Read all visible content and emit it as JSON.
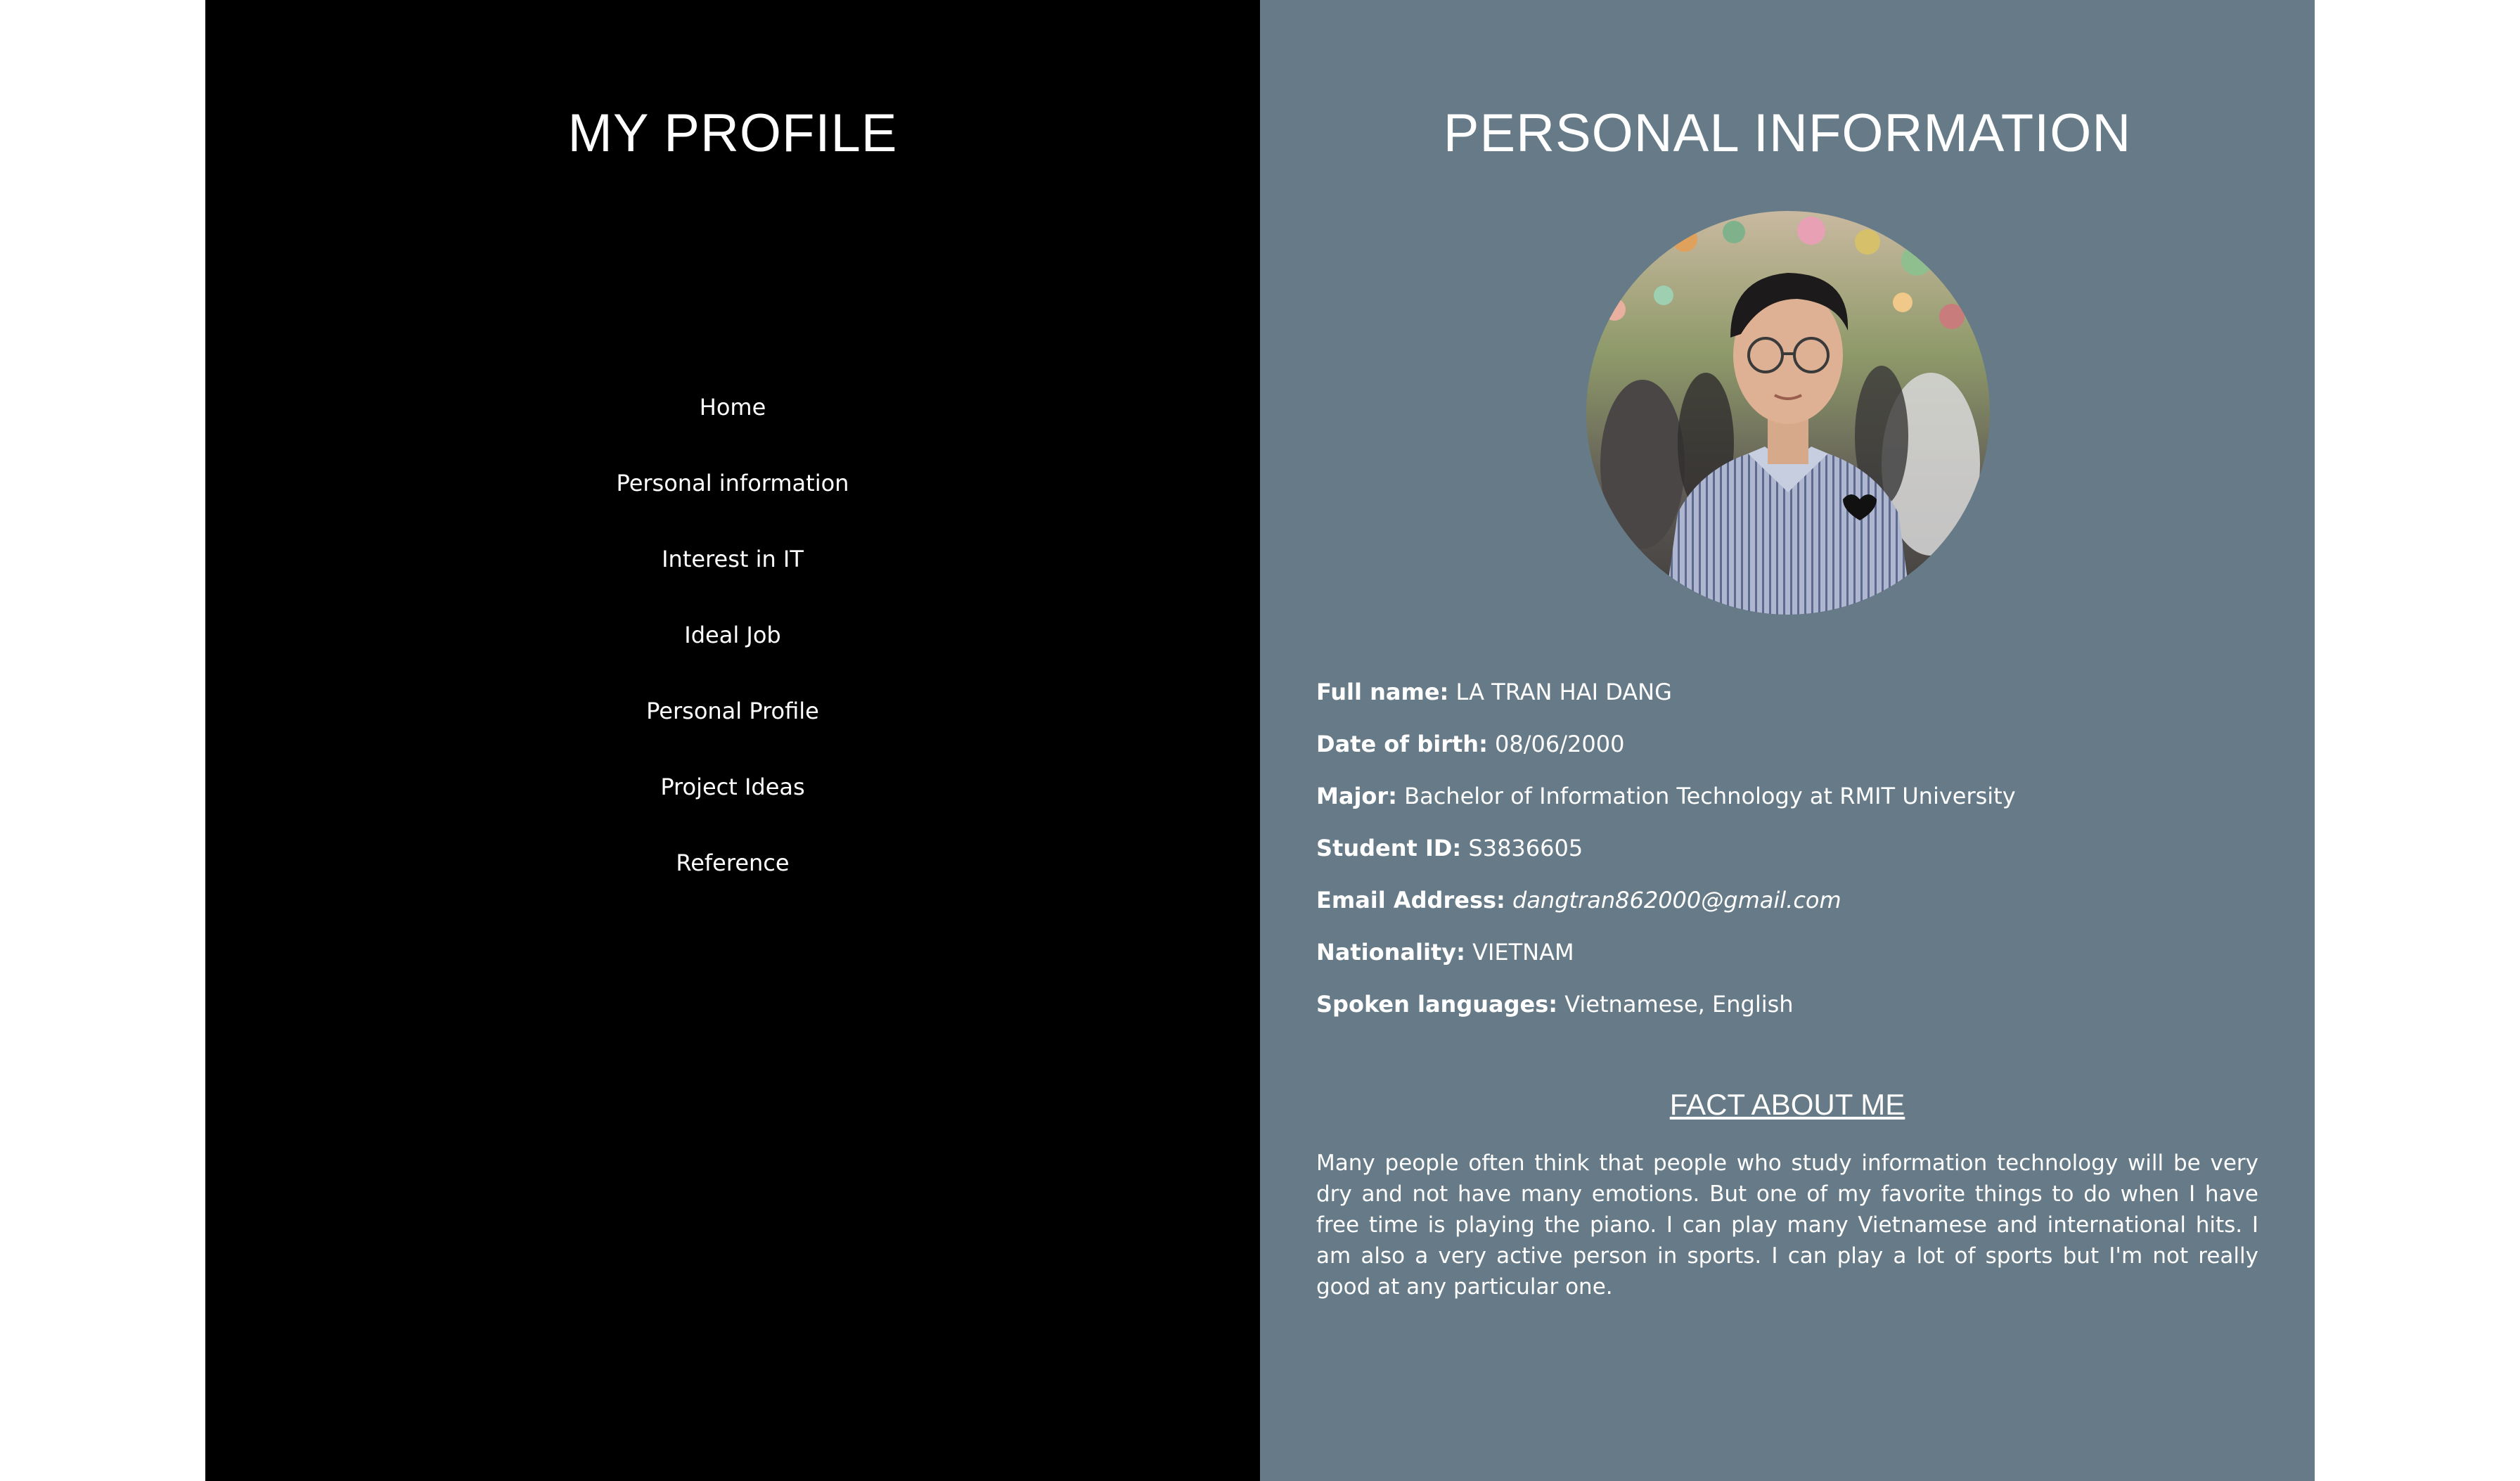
{
  "sidebar": {
    "title": "MY PROFILE",
    "nav": [
      {
        "label": "Home"
      },
      {
        "label": "Personal information"
      },
      {
        "label": "Interest in IT"
      },
      {
        "label": "Ideal Job"
      },
      {
        "label": "Personal Profile"
      },
      {
        "label": "Project Ideas"
      },
      {
        "label": "Reference"
      }
    ]
  },
  "main": {
    "title": "PERSONAL INFORMATION",
    "info": {
      "full_name": {
        "label": "Full name:",
        "value": "LA TRAN HAI DANG"
      },
      "dob": {
        "label": "Date of birth:",
        "value": "08/06/2000"
      },
      "major": {
        "label": "Major:",
        "value": "Bachelor of Information Technology at RMIT University"
      },
      "student_id": {
        "label": "Student ID:",
        "value": "S3836605"
      },
      "email": {
        "label": "Email Address:",
        "value": "dangtran862000@gmail.com"
      },
      "nationality": {
        "label": "Nationality:",
        "value": "VIETNAM"
      },
      "languages": {
        "label": "Spoken languages:",
        "value": "Vietnamese, English"
      }
    },
    "fact": {
      "title": "FACT ABOUT ME",
      "text": "Many people often think that people who study information technology will be very dry and not have many emotions. But one of my favorite things to do when I have free time is playing the piano. I can play many Vietnamese and international hits. I am also a very active person in sports. I can play a lot of sports but I'm not really good at any particular one."
    }
  },
  "colors": {
    "sidebar_bg": "#000000",
    "main_bg": "#667b87",
    "text": "#ffffff"
  }
}
